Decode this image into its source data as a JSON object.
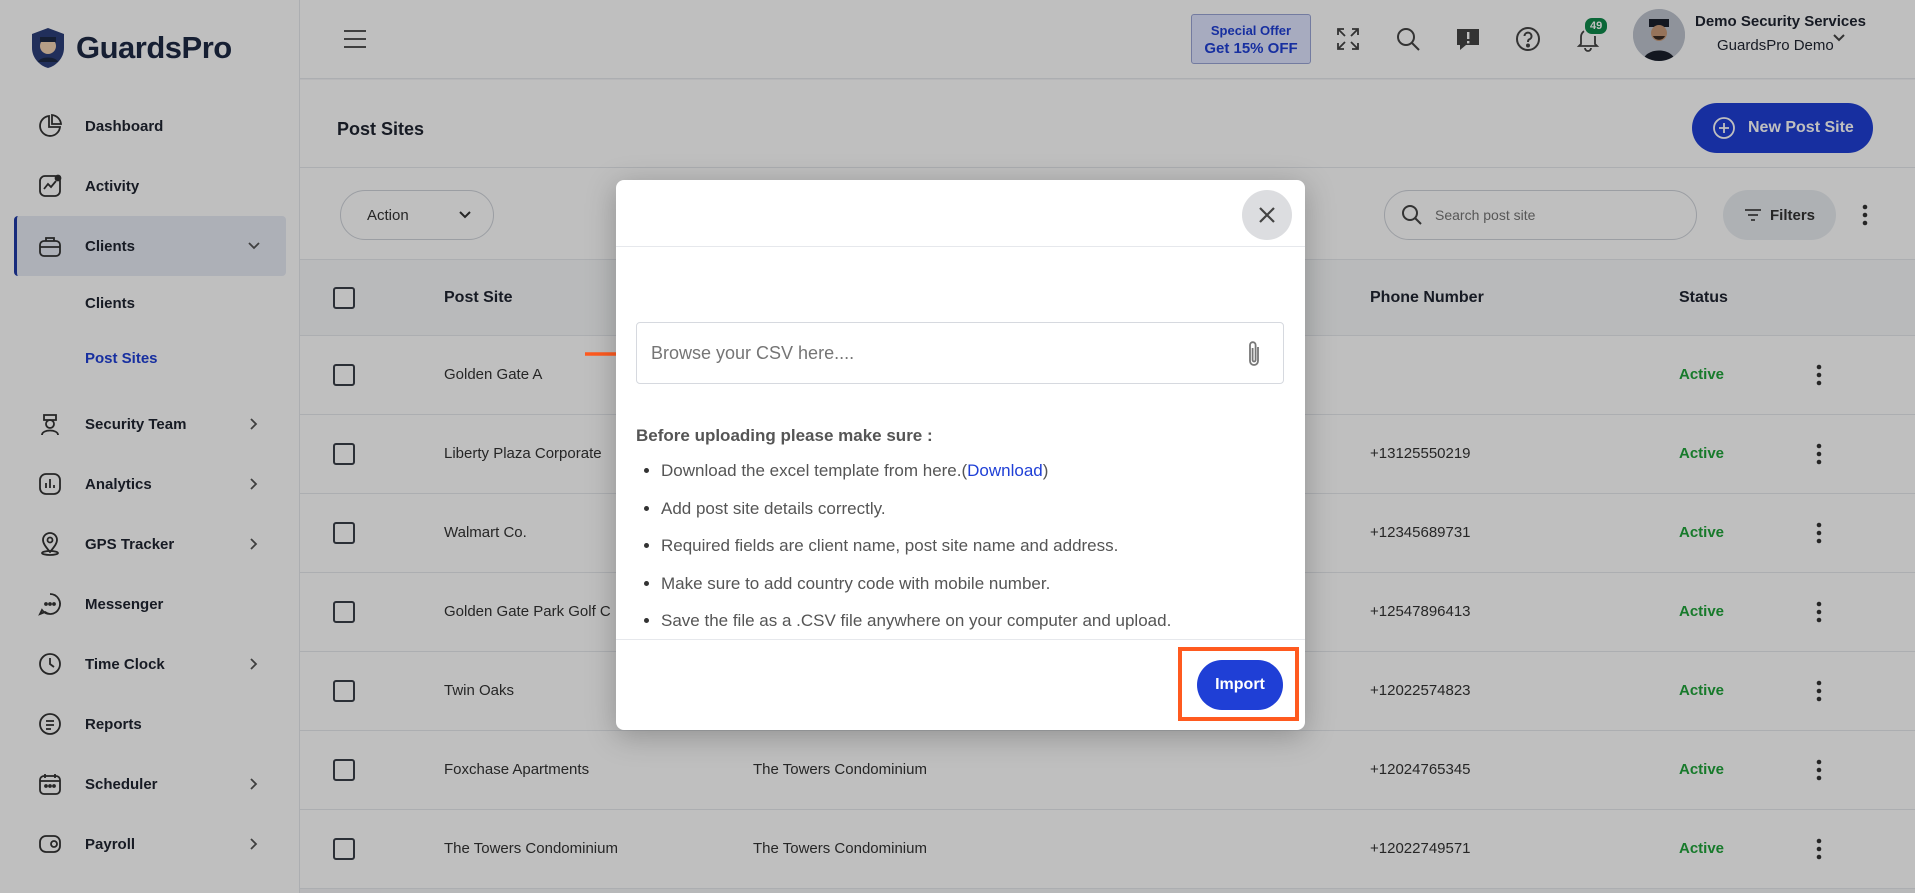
{
  "app": {
    "name": "GuardsPro"
  },
  "sidebar": {
    "items": [
      {
        "label": "Dashboard",
        "icon": "dashboard-icon"
      },
      {
        "label": "Activity",
        "icon": "activity-icon"
      },
      {
        "label": "Clients",
        "icon": "clients-icon",
        "expanded": true
      },
      {
        "label": "Security Team",
        "icon": "security-team-icon"
      },
      {
        "label": "Analytics",
        "icon": "analytics-icon"
      },
      {
        "label": "GPS Tracker",
        "icon": "gps-icon"
      },
      {
        "label": "Messenger",
        "icon": "messenger-icon"
      },
      {
        "label": "Time Clock",
        "icon": "clock-icon"
      },
      {
        "label": "Reports",
        "icon": "reports-icon"
      },
      {
        "label": "Scheduler",
        "icon": "calendar-icon"
      },
      {
        "label": "Payroll",
        "icon": "payroll-icon"
      }
    ],
    "sub_items": [
      {
        "label": "Clients"
      },
      {
        "label": "Post Sites"
      }
    ]
  },
  "header": {
    "offer_line1": "Special Offer",
    "offer_line2": "Get 15% OFF",
    "notification_count": "49",
    "user_name": "Demo Security Services",
    "user_org": "GuardsPro Demo"
  },
  "page": {
    "title": "Post Sites",
    "new_button": "New Post Site",
    "action_label": "Action",
    "search_placeholder": "Search post site",
    "filters_label": "Filters"
  },
  "table": {
    "columns": [
      "Post Site",
      "Phone Number",
      "Status"
    ],
    "rows": [
      {
        "post_site": "Golden Gate A",
        "client": "",
        "phone": "",
        "status": "Active"
      },
      {
        "post_site": "Liberty Plaza Corporate",
        "client": "",
        "phone": "+13125550219",
        "status": "Active"
      },
      {
        "post_site": "Walmart Co.",
        "client": "",
        "phone": "+12345689731",
        "status": "Active"
      },
      {
        "post_site": "Golden Gate Park Golf C",
        "client": "",
        "phone": "+12547896413",
        "status": "Active"
      },
      {
        "post_site": "Twin Oaks",
        "client": "",
        "phone": "+12022574823",
        "status": "Active"
      },
      {
        "post_site": "Foxchase Apartments",
        "client": "The Towers Condominium",
        "phone": "+12024765345",
        "status": "Active"
      },
      {
        "post_site": "The Towers Condominium",
        "client": "The Towers Condominium",
        "phone": "+12022749571",
        "status": "Active"
      }
    ]
  },
  "modal": {
    "upload_placeholder": "Browse your CSV here....",
    "note_title": "Before uploading please make sure :",
    "notes": [
      "Download the excel template from here.(",
      "Add post site details correctly.",
      "Required fields are client name, post site name and address.",
      "Make sure to add country code with mobile number.",
      "Save the file as a .CSV file anywhere on your computer and upload."
    ],
    "download_link": "Download",
    "download_close": ")",
    "import_label": "Import"
  },
  "colors": {
    "primary": "#1f3fd6",
    "active_status": "#1fa33a",
    "highlight": "#ff5a1f",
    "badge": "#0f8a4b"
  }
}
